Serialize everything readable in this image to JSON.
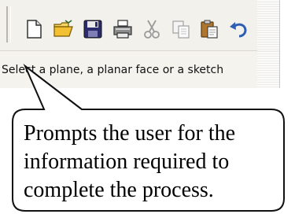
{
  "toolbar": {
    "items": [
      {
        "name": "new-document-icon"
      },
      {
        "name": "open-folder-icon"
      },
      {
        "name": "save-disk-icon"
      },
      {
        "name": "print-icon"
      },
      {
        "name": "cut-scissors-icon"
      },
      {
        "name": "copy-icon"
      },
      {
        "name": "paste-icon"
      },
      {
        "name": "undo-icon"
      }
    ]
  },
  "statusbar": {
    "prompt_text": "Select a plane, a planar face or a sketch"
  },
  "callout": {
    "line1": "Prompts the user for the",
    "line2": "information required to",
    "line3": "complete the process."
  }
}
